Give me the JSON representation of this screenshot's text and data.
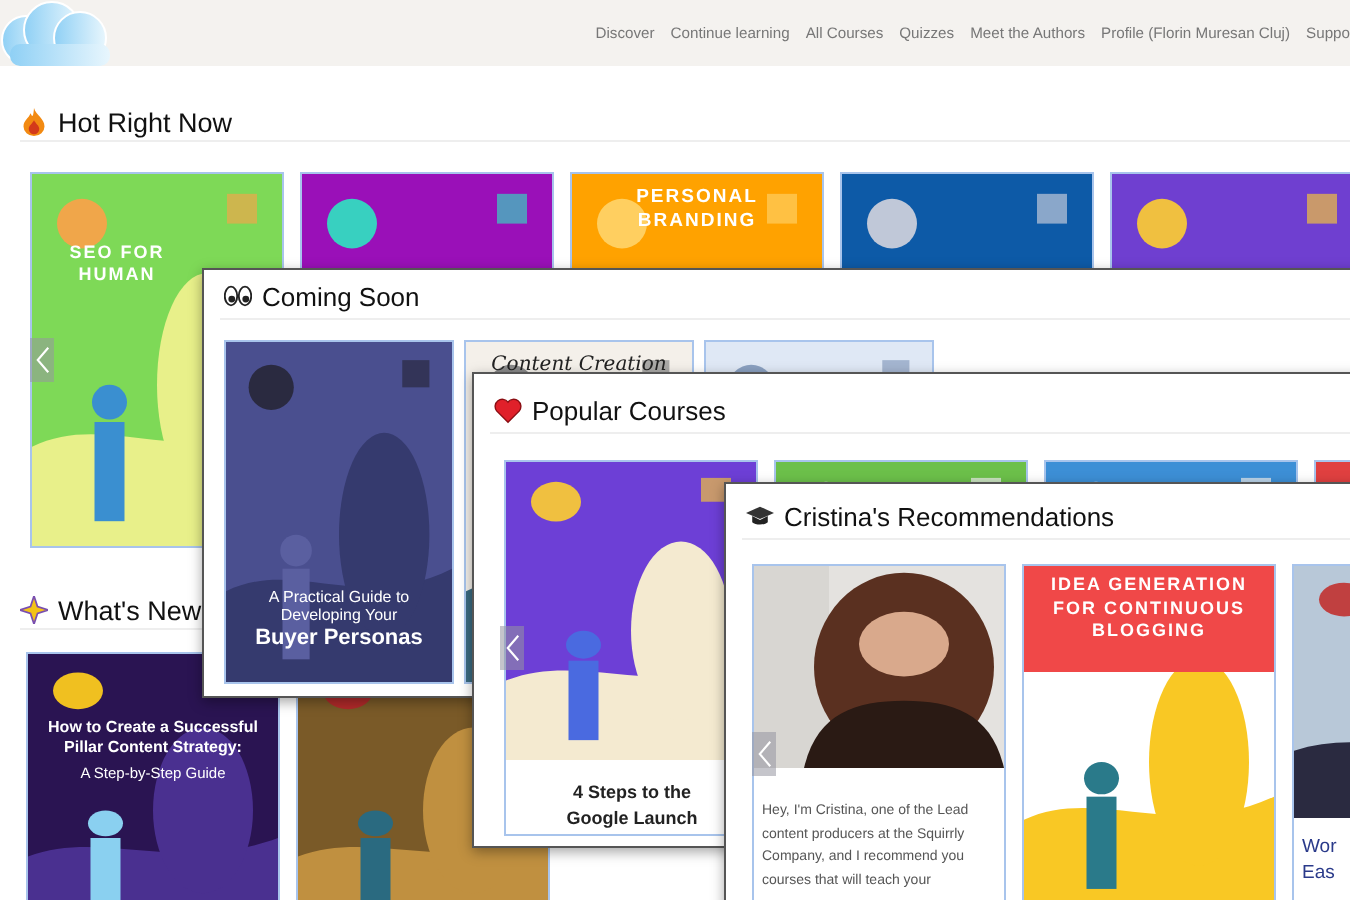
{
  "nav": {
    "links": [
      "Discover",
      "Continue learning",
      "All Courses",
      "Quizzes",
      "Meet the Authors",
      "Profile (Florin Muresan Cluj)",
      "Suppo"
    ]
  },
  "sections": [
    {
      "title": "Hot Right Now",
      "cards": [
        {
          "kind": "picture",
          "title": "SEO FOR HUMAN"
        },
        {
          "kind": "picture"
        },
        {
          "kind": "picture",
          "title": "PERSONAL BRANDING"
        },
        {
          "kind": "picture"
        },
        {
          "kind": "picture"
        }
      ]
    },
    {
      "title": "What's New",
      "cards": [
        {
          "kind": "picture",
          "title": "How to Create a Successful Pillar Content Strategy:",
          "subtitle": "A Step-by-Step Guide"
        },
        {
          "kind": "picture"
        }
      ]
    }
  ],
  "windows": [
    {
      "title": "Coming Soon",
      "cards": [
        {
          "kind": "picture",
          "title": "A Practical Guide to Developing Your",
          "subtitle": "Buyer Personas"
        },
        {
          "kind": "picture",
          "title": "Content Creation"
        },
        {
          "kind": "picture"
        }
      ]
    },
    {
      "title": "Popular Courses",
      "cards": [
        {
          "kind": "picture",
          "caption": "4 Steps to the Google Launch"
        },
        {
          "kind": "picture"
        },
        {
          "kind": "picture"
        },
        {
          "kind": "picture"
        }
      ]
    },
    {
      "title": "Cristina's Recommendations",
      "cards": [
        {
          "text": "Hey, I'm Cristina, one of the Lead content producers at the Squirrly Company, and I recommend you courses that will teach your"
        },
        {
          "kind": "picture",
          "title": "IDEA GENERATION FOR CONTINUOUS BLOGGING"
        },
        {
          "kind": "picture",
          "caption": "Wor Eas"
        }
      ]
    }
  ]
}
